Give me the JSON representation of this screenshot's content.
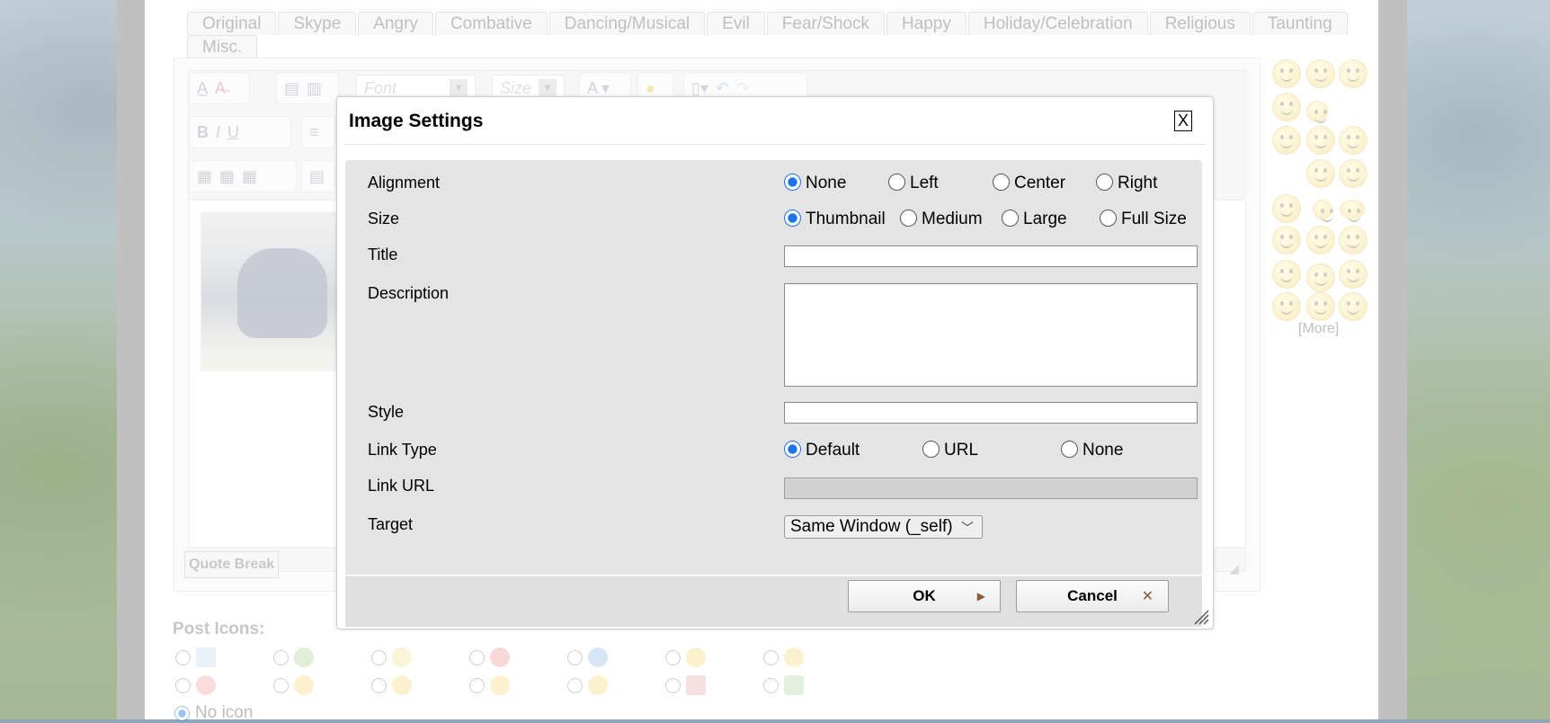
{
  "smiley_tabs": [
    "Original",
    "Skype",
    "Angry",
    "Combative",
    "Dancing/Musical",
    "Evil",
    "Fear/Shock",
    "Happy",
    "Holiday/Celebration",
    "Religious",
    "Taunting",
    "Misc."
  ],
  "editor": {
    "font_placeholder": "Font",
    "size_placeholder": "Size",
    "quote_break": "Quote Break"
  },
  "smiley_panel": {
    "more_link": "[More]"
  },
  "post_icons": {
    "label": "Post Icons:",
    "no_icon_label": "No icon"
  },
  "dialog": {
    "title": "Image Settings",
    "close_label": "X",
    "alignment": {
      "label": "Alignment",
      "options": [
        "None",
        "Left",
        "Center",
        "Right"
      ],
      "selected": "None"
    },
    "size": {
      "label": "Size",
      "options": [
        "Thumbnail",
        "Medium",
        "Large",
        "Full Size"
      ],
      "selected": "Thumbnail"
    },
    "title_field": {
      "label": "Title",
      "value": ""
    },
    "description_field": {
      "label": "Description",
      "value": ""
    },
    "style_field": {
      "label": "Style",
      "value": ""
    },
    "link_type": {
      "label": "Link Type",
      "options": [
        "Default",
        "URL",
        "None"
      ],
      "selected": "Default"
    },
    "link_url": {
      "label": "Link URL",
      "value": ""
    },
    "target": {
      "label": "Target",
      "value": "Same Window (_self)"
    },
    "ok_label": "OK",
    "cancel_label": "Cancel"
  },
  "colors": {
    "accent": "#1a73e8",
    "dialog_body": "#e4e4e4"
  }
}
